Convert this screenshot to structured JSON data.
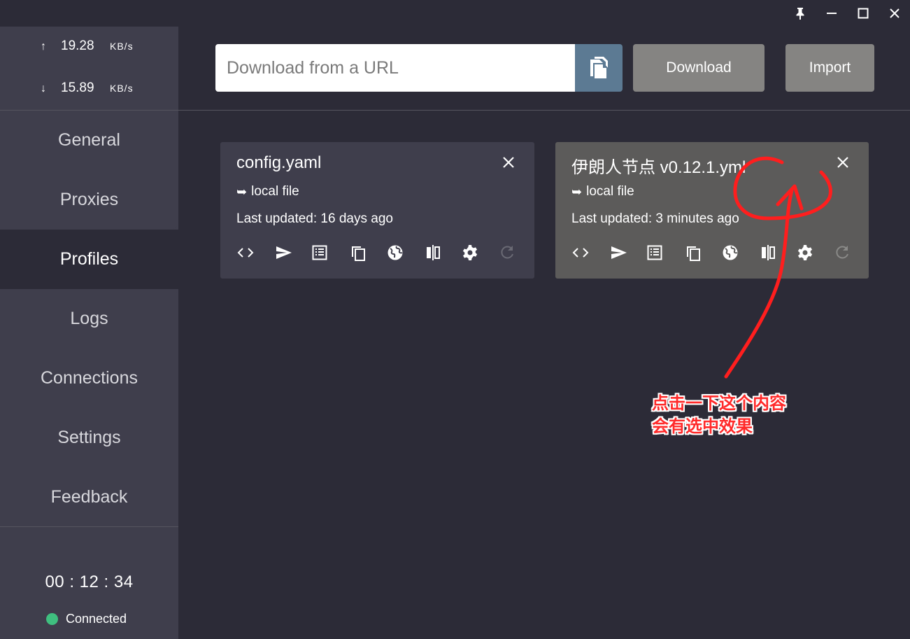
{
  "window": {
    "pin_icon": "pin-icon",
    "minimize_icon": "minimize-icon",
    "maximize_icon": "maximize-icon",
    "close_icon": "close-icon"
  },
  "traffic": {
    "up_arrow": "↑",
    "up_value": "19.28",
    "up_unit": "KB/s",
    "down_arrow": "↓",
    "down_value": "15.89",
    "down_unit": "KB/s"
  },
  "sidebar": {
    "items": [
      {
        "label": "General"
      },
      {
        "label": "Proxies"
      },
      {
        "label": "Profiles"
      },
      {
        "label": "Logs"
      },
      {
        "label": "Connections"
      },
      {
        "label": "Settings"
      },
      {
        "label": "Feedback"
      }
    ],
    "active": "Profiles"
  },
  "footer": {
    "uptime": "00 : 12 : 34",
    "status": "Connected",
    "status_color": "#3fbf7f"
  },
  "topbar": {
    "url_placeholder": "Download from a URL",
    "url_value": "",
    "paste_icon": "paste-icon",
    "download_label": "Download",
    "import_label": "Import"
  },
  "profiles": [
    {
      "name": "config.yaml",
      "source_arrow": "➥",
      "source": "local file",
      "updated": "Last updated: 16 days ago",
      "selected": false
    },
    {
      "name": "伊朗人节点 v0.12.1.yml",
      "source_arrow": "➥",
      "source": "local file",
      "updated": "Last updated: 3 minutes ago",
      "selected": true
    }
  ],
  "profile_actions": [
    "code-icon",
    "send-icon",
    "list-icon",
    "copy-icon",
    "globe-icon",
    "compare-icon",
    "gear-icon",
    "refresh-icon"
  ],
  "annotation": {
    "line1": "点击一下这个内容",
    "line2": "会有选中效果",
    "color": "#ff2a2a"
  },
  "colors": {
    "background": "#2c2b37",
    "sidebar": "#3f3e4c",
    "card_selected": "#5c5b5a",
    "paste_button": "#5c7a93",
    "gray_button": "#858482"
  }
}
